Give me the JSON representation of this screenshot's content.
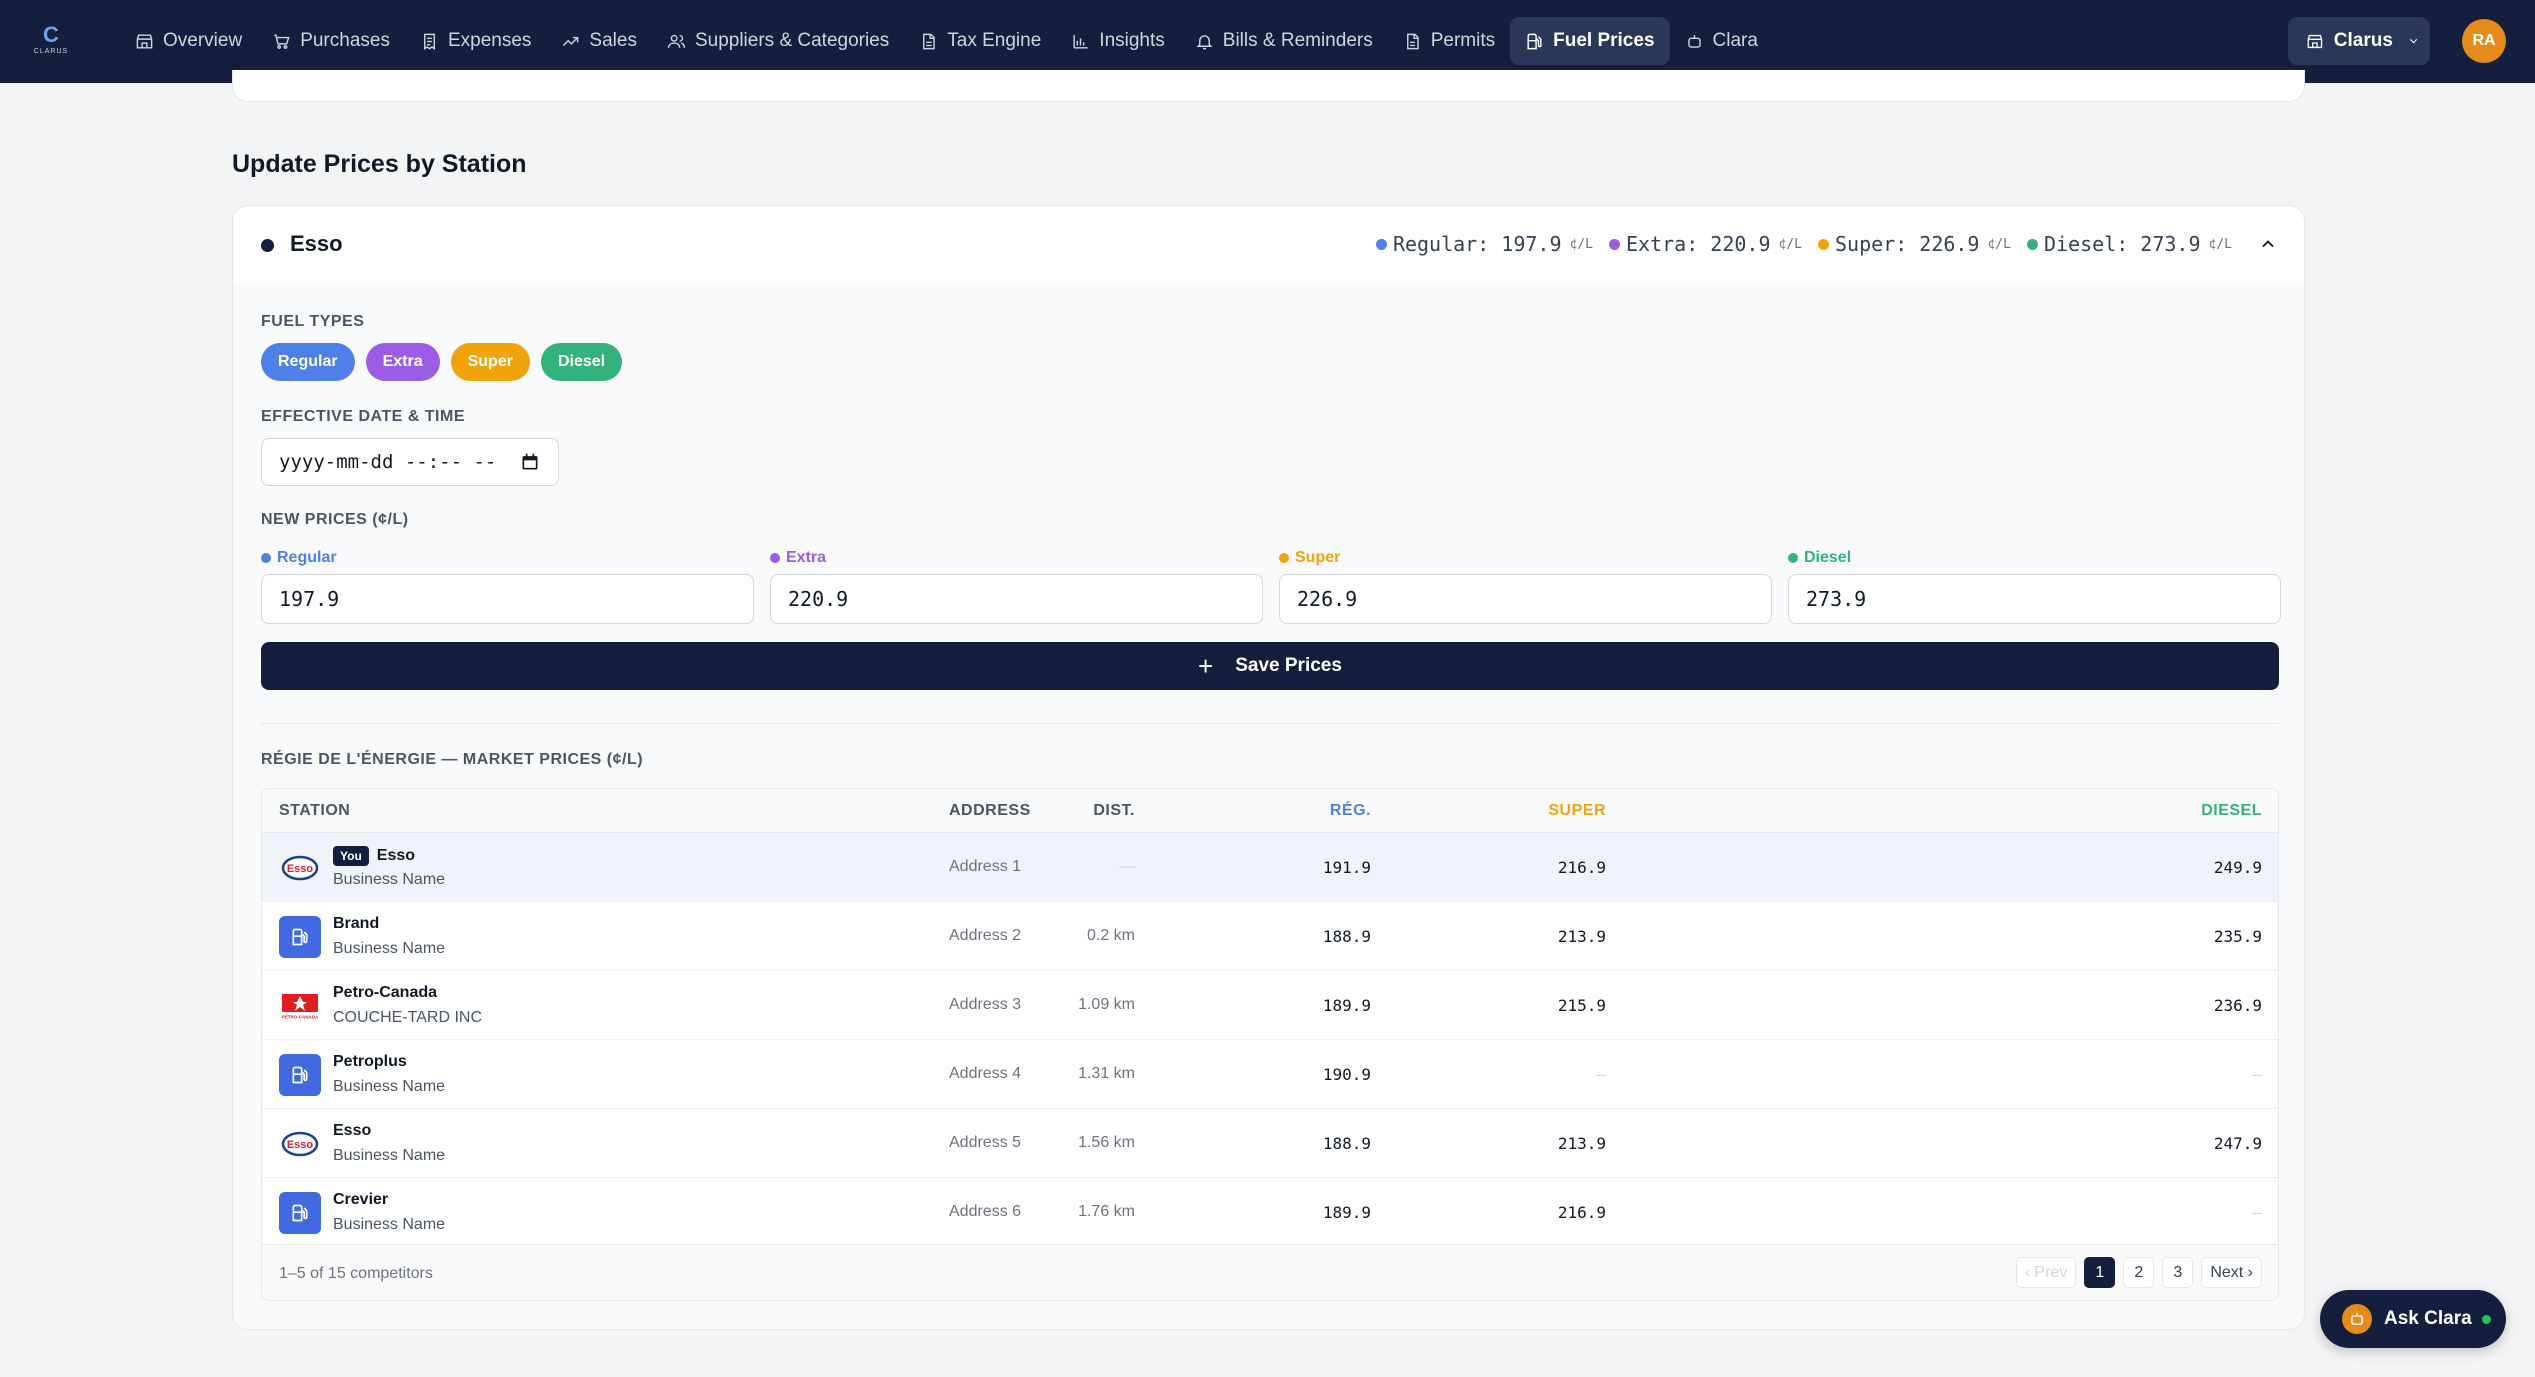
{
  "app": {
    "logo_text": "CLARUS",
    "logo_mark": "C"
  },
  "nav": {
    "items": [
      {
        "label": "Overview",
        "icon": "store-icon"
      },
      {
        "label": "Purchases",
        "icon": "cart-icon"
      },
      {
        "label": "Expenses",
        "icon": "receipt-icon"
      },
      {
        "label": "Sales",
        "icon": "trending-up-icon"
      },
      {
        "label": "Suppliers & Categories",
        "icon": "users-icon"
      },
      {
        "label": "Tax Engine",
        "icon": "document-icon"
      },
      {
        "label": "Insights",
        "icon": "bar-chart-icon"
      },
      {
        "label": "Bills & Reminders",
        "icon": "bell-icon"
      },
      {
        "label": "Permits",
        "icon": "file-icon"
      },
      {
        "label": "Fuel Prices",
        "icon": "fuel-pump-icon",
        "active": true
      },
      {
        "label": "Clara",
        "icon": "bot-icon"
      }
    ],
    "org": "Clarus",
    "avatar": "RA"
  },
  "section_title": "Update Prices by Station",
  "station": {
    "name": "Esso",
    "summary": [
      {
        "label": "Regular: 197.9",
        "unit": "¢/L",
        "color": "#4f7fe8"
      },
      {
        "label": "Extra: 220.9",
        "unit": "¢/L",
        "color": "#9b5de5"
      },
      {
        "label": "Super: 226.9",
        "unit": "¢/L",
        "color": "#f0a30a"
      },
      {
        "label": "Diesel: 273.9",
        "unit": "¢/L",
        "color": "#34b27b"
      }
    ]
  },
  "form": {
    "fuel_types_label": "FUEL TYPES",
    "fuel_types": [
      {
        "label": "Regular",
        "color": "#4f7fe8"
      },
      {
        "label": "Extra",
        "color": "#9b5de5"
      },
      {
        "label": "Super",
        "color": "#f0a30a"
      },
      {
        "label": "Diesel",
        "color": "#34b27b"
      }
    ],
    "date_label": "EFFECTIVE DATE & TIME",
    "date_placeholder": "yyyy-mm-dd --:-- --",
    "prices_label": "NEW PRICES (¢/L)",
    "prices": [
      {
        "label": "Regular",
        "value": "197.9",
        "color": "#4f7fe8"
      },
      {
        "label": "Extra",
        "value": "220.9",
        "color": "#9b5de5"
      },
      {
        "label": "Super",
        "value": "226.9",
        "color": "#f0a30a"
      },
      {
        "label": "Diesel",
        "value": "273.9",
        "color": "#34b27b"
      }
    ],
    "save_label": "Save Prices"
  },
  "market": {
    "title": "RÉGIE DE L'ÉNERGIE — MARKET PRICES (¢/L)",
    "headers": {
      "station": "STATION",
      "address": "ADDRESS",
      "dist": "DIST.",
      "reg": "RÉG.",
      "super": "SUPER",
      "diesel": "DIESEL"
    },
    "you_badge": "You",
    "rows": [
      {
        "brand": "Esso",
        "sub": "Business Name",
        "address": "Address 1",
        "dist": "—",
        "reg": "191.9",
        "super": "216.9",
        "diesel": "249.9",
        "logo": "esso",
        "you": true
      },
      {
        "brand": "Brand",
        "sub": "Business Name",
        "address": "Address 2",
        "dist": "0.2 km",
        "reg": "188.9",
        "super": "213.9",
        "diesel": "235.9",
        "logo": "pump"
      },
      {
        "brand": "Petro-Canada",
        "sub": "COUCHE-TARD INC",
        "address": "Address 3",
        "dist": "1.09 km",
        "reg": "189.9",
        "super": "215.9",
        "diesel": "236.9",
        "logo": "petro"
      },
      {
        "brand": "Petroplus",
        "sub": "Business Name",
        "address": "Address 4",
        "dist": "1.31 km",
        "reg": "190.9",
        "super": "—",
        "diesel": "—",
        "logo": "pump"
      },
      {
        "brand": "Esso",
        "sub": "Business Name",
        "address": "Address 5",
        "dist": "1.56 km",
        "reg": "188.9",
        "super": "213.9",
        "diesel": "247.9",
        "logo": "esso"
      },
      {
        "brand": "Crevier",
        "sub": "Business Name",
        "address": "Address 6",
        "dist": "1.76 km",
        "reg": "189.9",
        "super": "216.9",
        "diesel": "—",
        "logo": "pump"
      }
    ],
    "footer_count": "1–5 of 15 competitors",
    "pager": {
      "prev": "‹ Prev",
      "pages": [
        "1",
        "2",
        "3"
      ],
      "next": "Next ›"
    }
  },
  "ask_clara": "Ask Clara"
}
